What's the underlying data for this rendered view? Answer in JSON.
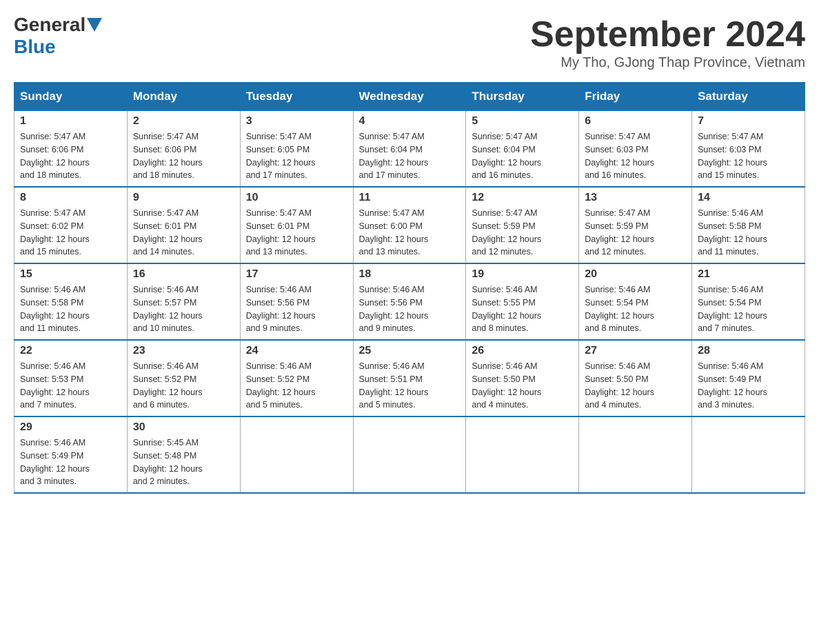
{
  "logo": {
    "text_general": "General",
    "text_blue": "Blue",
    "arrow_color": "#1a6faf"
  },
  "title": "September 2024",
  "subtitle": "My Tho, GJong Thap Province, Vietnam",
  "weekdays": [
    "Sunday",
    "Monday",
    "Tuesday",
    "Wednesday",
    "Thursday",
    "Friday",
    "Saturday"
  ],
  "weeks": [
    [
      {
        "day": "1",
        "sunrise": "5:47 AM",
        "sunset": "6:06 PM",
        "daylight": "12 hours and 18 minutes."
      },
      {
        "day": "2",
        "sunrise": "5:47 AM",
        "sunset": "6:06 PM",
        "daylight": "12 hours and 18 minutes."
      },
      {
        "day": "3",
        "sunrise": "5:47 AM",
        "sunset": "6:05 PM",
        "daylight": "12 hours and 17 minutes."
      },
      {
        "day": "4",
        "sunrise": "5:47 AM",
        "sunset": "6:04 PM",
        "daylight": "12 hours and 17 minutes."
      },
      {
        "day": "5",
        "sunrise": "5:47 AM",
        "sunset": "6:04 PM",
        "daylight": "12 hours and 16 minutes."
      },
      {
        "day": "6",
        "sunrise": "5:47 AM",
        "sunset": "6:03 PM",
        "daylight": "12 hours and 16 minutes."
      },
      {
        "day": "7",
        "sunrise": "5:47 AM",
        "sunset": "6:03 PM",
        "daylight": "12 hours and 15 minutes."
      }
    ],
    [
      {
        "day": "8",
        "sunrise": "5:47 AM",
        "sunset": "6:02 PM",
        "daylight": "12 hours and 15 minutes."
      },
      {
        "day": "9",
        "sunrise": "5:47 AM",
        "sunset": "6:01 PM",
        "daylight": "12 hours and 14 minutes."
      },
      {
        "day": "10",
        "sunrise": "5:47 AM",
        "sunset": "6:01 PM",
        "daylight": "12 hours and 13 minutes."
      },
      {
        "day": "11",
        "sunrise": "5:47 AM",
        "sunset": "6:00 PM",
        "daylight": "12 hours and 13 minutes."
      },
      {
        "day": "12",
        "sunrise": "5:47 AM",
        "sunset": "5:59 PM",
        "daylight": "12 hours and 12 minutes."
      },
      {
        "day": "13",
        "sunrise": "5:47 AM",
        "sunset": "5:59 PM",
        "daylight": "12 hours and 12 minutes."
      },
      {
        "day": "14",
        "sunrise": "5:46 AM",
        "sunset": "5:58 PM",
        "daylight": "12 hours and 11 minutes."
      }
    ],
    [
      {
        "day": "15",
        "sunrise": "5:46 AM",
        "sunset": "5:58 PM",
        "daylight": "12 hours and 11 minutes."
      },
      {
        "day": "16",
        "sunrise": "5:46 AM",
        "sunset": "5:57 PM",
        "daylight": "12 hours and 10 minutes."
      },
      {
        "day": "17",
        "sunrise": "5:46 AM",
        "sunset": "5:56 PM",
        "daylight": "12 hours and 9 minutes."
      },
      {
        "day": "18",
        "sunrise": "5:46 AM",
        "sunset": "5:56 PM",
        "daylight": "12 hours and 9 minutes."
      },
      {
        "day": "19",
        "sunrise": "5:46 AM",
        "sunset": "5:55 PM",
        "daylight": "12 hours and 8 minutes."
      },
      {
        "day": "20",
        "sunrise": "5:46 AM",
        "sunset": "5:54 PM",
        "daylight": "12 hours and 8 minutes."
      },
      {
        "day": "21",
        "sunrise": "5:46 AM",
        "sunset": "5:54 PM",
        "daylight": "12 hours and 7 minutes."
      }
    ],
    [
      {
        "day": "22",
        "sunrise": "5:46 AM",
        "sunset": "5:53 PM",
        "daylight": "12 hours and 7 minutes."
      },
      {
        "day": "23",
        "sunrise": "5:46 AM",
        "sunset": "5:52 PM",
        "daylight": "12 hours and 6 minutes."
      },
      {
        "day": "24",
        "sunrise": "5:46 AM",
        "sunset": "5:52 PM",
        "daylight": "12 hours and 5 minutes."
      },
      {
        "day": "25",
        "sunrise": "5:46 AM",
        "sunset": "5:51 PM",
        "daylight": "12 hours and 5 minutes."
      },
      {
        "day": "26",
        "sunrise": "5:46 AM",
        "sunset": "5:50 PM",
        "daylight": "12 hours and 4 minutes."
      },
      {
        "day": "27",
        "sunrise": "5:46 AM",
        "sunset": "5:50 PM",
        "daylight": "12 hours and 4 minutes."
      },
      {
        "day": "28",
        "sunrise": "5:46 AM",
        "sunset": "5:49 PM",
        "daylight": "12 hours and 3 minutes."
      }
    ],
    [
      {
        "day": "29",
        "sunrise": "5:46 AM",
        "sunset": "5:49 PM",
        "daylight": "12 hours and 3 minutes."
      },
      {
        "day": "30",
        "sunrise": "5:45 AM",
        "sunset": "5:48 PM",
        "daylight": "12 hours and 2 minutes."
      },
      null,
      null,
      null,
      null,
      null
    ]
  ],
  "labels": {
    "sunrise_prefix": "Sunrise: ",
    "sunset_prefix": "Sunset: ",
    "daylight_prefix": "Daylight: "
  }
}
